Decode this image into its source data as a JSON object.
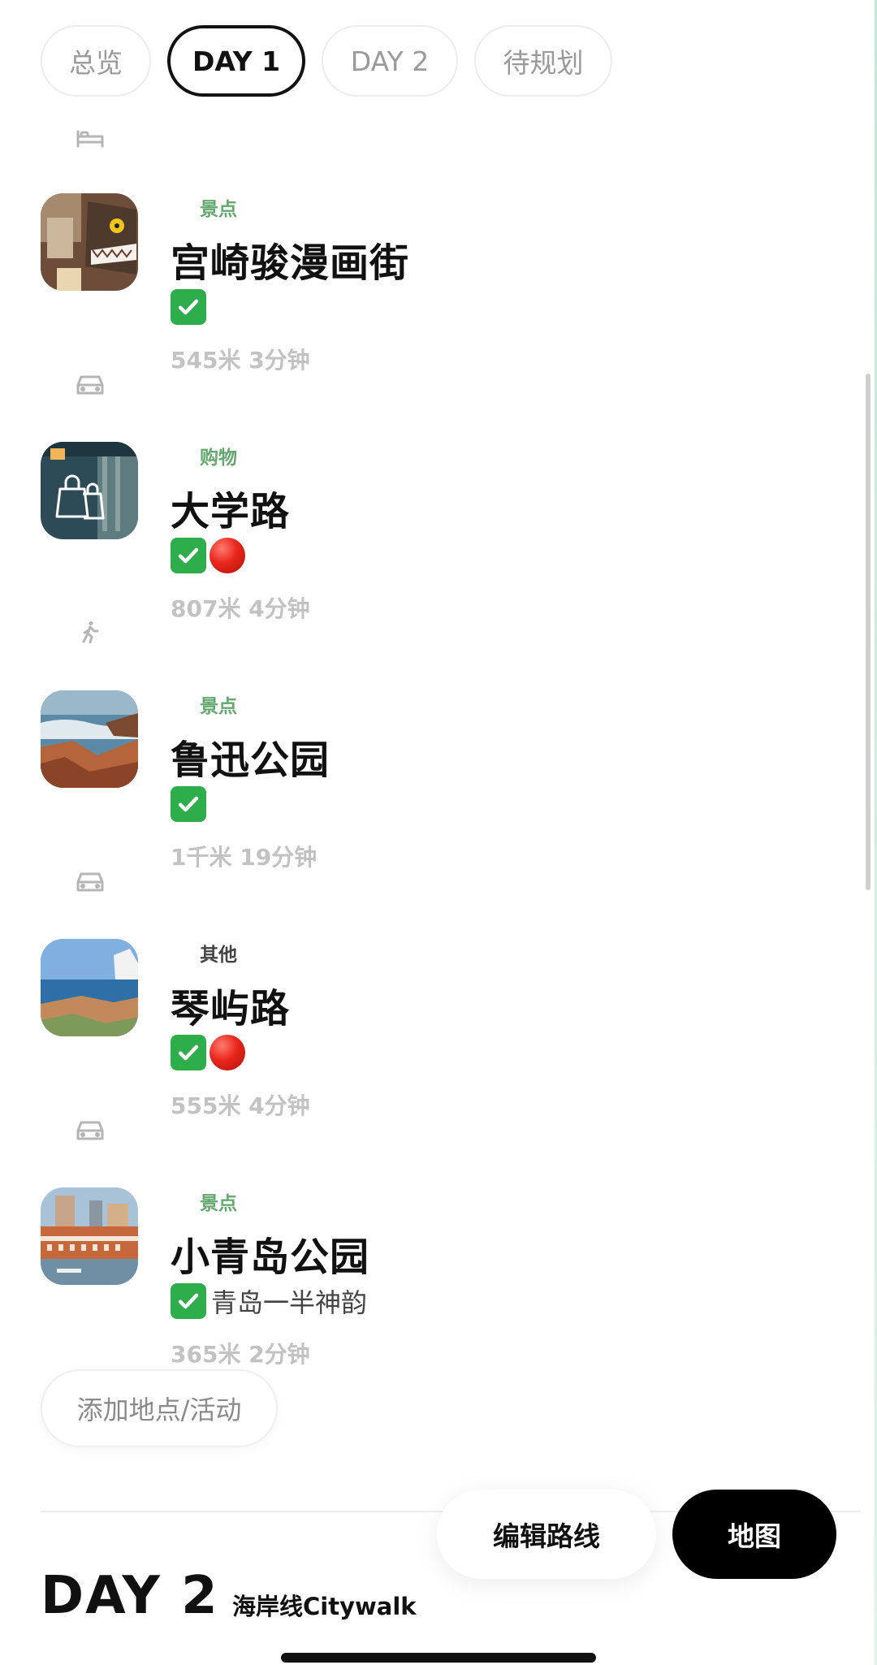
{
  "tabs": [
    {
      "label": "总览",
      "active": false
    },
    {
      "label": "DAY 1",
      "active": true
    },
    {
      "label": "DAY 2",
      "active": false
    },
    {
      "label": "待规划",
      "active": false
    }
  ],
  "transport_modes": [
    "bed-icon",
    "car-icon",
    "walk-icon",
    "car-icon",
    "car-icon"
  ],
  "items": [
    {
      "category": "景点",
      "name": "宫崎骏漫画街",
      "checked": true,
      "red_dot": false,
      "note": "",
      "distance": "545米 3分钟",
      "thumb": "catbus-photo"
    },
    {
      "category": "购物",
      "name": "大学路",
      "checked": true,
      "red_dot": true,
      "note": "",
      "distance": "807米 4分钟",
      "thumb": "shopping-bag-photo"
    },
    {
      "category": "景点",
      "name": "鲁迅公园",
      "checked": true,
      "red_dot": false,
      "note": "",
      "distance": "1千米 19分钟",
      "thumb": "seaside-rocks-photo"
    },
    {
      "category": "其他",
      "name": "琴屿路",
      "checked": true,
      "red_dot": true,
      "note": "",
      "distance": "555米 4分钟",
      "thumb": "coast-photo"
    },
    {
      "category": "景点",
      "name": "小青岛公园",
      "checked": true,
      "red_dot": false,
      "note": "青岛一半神韵",
      "distance": "365米 2分钟",
      "thumb": "old-town-photo"
    }
  ],
  "add_button": "添加地点/活动",
  "edit_route_button": "编辑路线",
  "map_button": "地图",
  "next_day": {
    "title": "DAY 2",
    "subtitle": "海岸线Citywalk"
  },
  "colors": {
    "category_green": "#65a86f",
    "check_green": "#2eae4b",
    "red_dot": "#e8261b",
    "active_tab_border": "#111111"
  }
}
